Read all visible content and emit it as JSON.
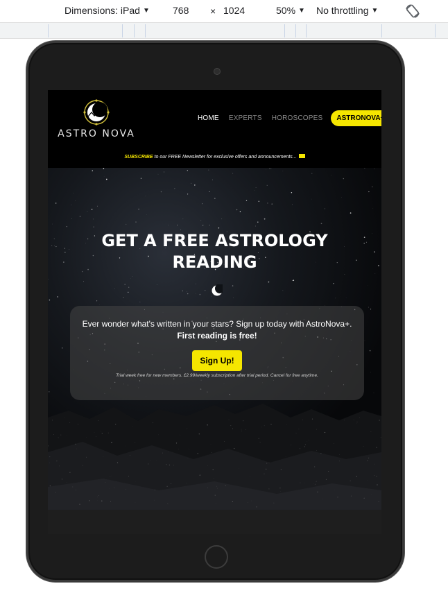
{
  "devtools": {
    "dimensions_label": "Dimensions: iPad",
    "width": "768",
    "times": "×",
    "height": "1024",
    "zoom": "50%",
    "throttle": "No throttling",
    "rotate_icon": "rotate-icon"
  },
  "site": {
    "logo_text": "ASTRO NOVA",
    "nav": {
      "home": "HOME",
      "experts": "EXPERTS",
      "horoscopes": "HOROSCOPES",
      "cta": "ASTRONOVA+"
    },
    "announcement": {
      "subscribe": "SUBSCRIBE",
      "text": " to our FREE Newsletter for exclusive offers and announcements..."
    },
    "hero": {
      "title_line1": "GET A FREE ASTROLOGY",
      "title_line2": "READING",
      "card_text": "Ever wonder what's written in your stars? Sign up today with AstroNova+.",
      "card_bold": "First reading is free!",
      "button": "Sign Up!",
      "fine_print": "Trial week free for new members. £2.99/weekly subscription after trial period. Cancel for free anytime."
    }
  },
  "colors": {
    "accent": "#f5e600",
    "header_bg": "#000000",
    "device_frame": "#1c1c1c"
  }
}
